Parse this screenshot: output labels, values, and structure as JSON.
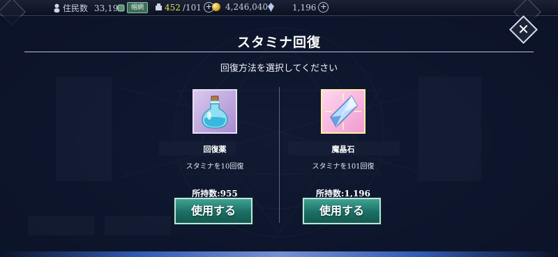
{
  "hud": {
    "residents_label": "住民数",
    "residents_value": "33,190",
    "rank_badge": "帽網",
    "stamina_current": "452",
    "stamina_max": "/101",
    "coins": "4,246,040",
    "gems": "1,196"
  },
  "dialog": {
    "title": "スタミナ回復",
    "subtitle": "回復方法を選択してください",
    "close_icon": "close-icon"
  },
  "items": [
    {
      "name": "回復薬",
      "desc": "スタミナを10回復",
      "owned": "所持数:955",
      "button": "使用する",
      "icon": "potion-bottle-icon"
    },
    {
      "name": "魔晶石",
      "desc": "スタミナを101回復",
      "owned": "所持数:1,196",
      "button": "使用する",
      "icon": "magic-crystal-icon"
    }
  ],
  "colors": {
    "button": "#1b6e63",
    "overlay": "#0e162c",
    "stamina": "#d7e25a"
  }
}
